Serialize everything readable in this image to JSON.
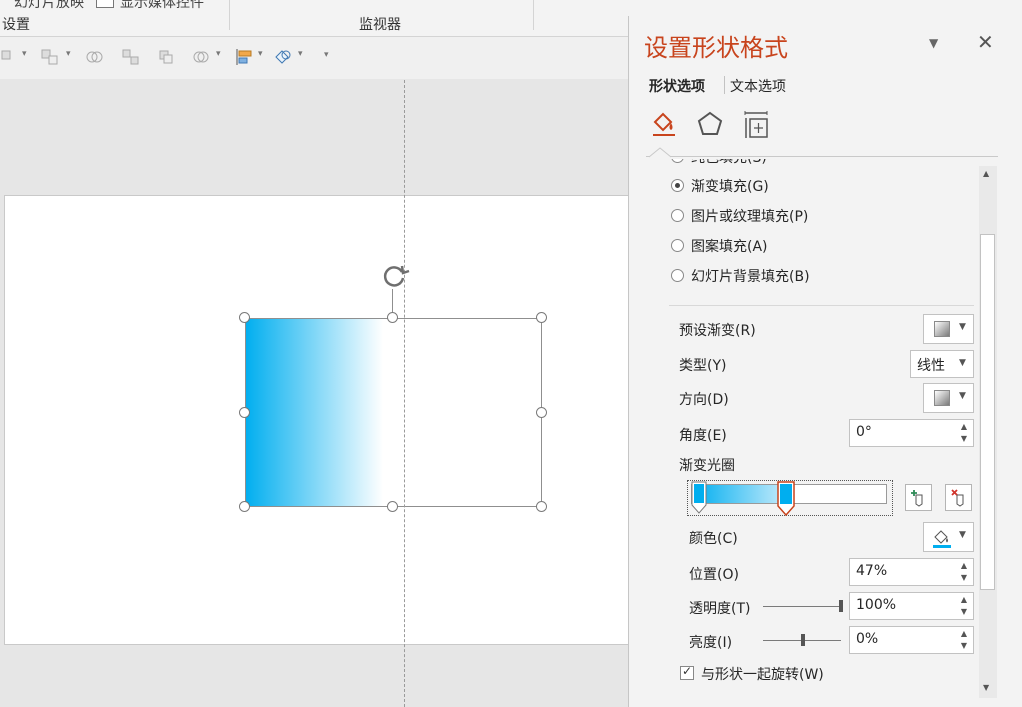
{
  "ribbon": {
    "cut_text_1": "幻灯片放映",
    "cut_text_2": "显示媒体控件",
    "group_settings": "设置",
    "group_monitors": "监视器"
  },
  "pane": {
    "title": "设置形状格式",
    "tab_shape": "形状选项",
    "tab_text": "文本选项",
    "fill_options": [
      {
        "label": "纯色填充(S)",
        "checked": false
      },
      {
        "label": "渐变填充(G)",
        "checked": true
      },
      {
        "label": "图片或纹理填充(P)",
        "checked": false
      },
      {
        "label": "图案填充(A)",
        "checked": false
      },
      {
        "label": "幻灯片背景填充(B)",
        "checked": false
      }
    ],
    "preset_gradient_label": "预设渐变(R)",
    "type_label": "类型(Y)",
    "type_value": "线性",
    "direction_label": "方向(D)",
    "angle_label": "角度(E)",
    "angle_value": "0°",
    "gradient_stops_label": "渐变光圈",
    "color_label": "颜色(C)",
    "position_label": "位置(O)",
    "position_value": "47%",
    "transparency_label": "透明度(T)",
    "transparency_value": "100%",
    "brightness_label": "亮度(I)",
    "brightness_value": "0%",
    "rotate_with_shape_label": "与形状一起旋转(W)",
    "rotate_with_shape_checked": true
  },
  "colors": {
    "accent": "#c8441d",
    "gradient_start": "#00aeef",
    "gradient_end": "#ffffff"
  }
}
